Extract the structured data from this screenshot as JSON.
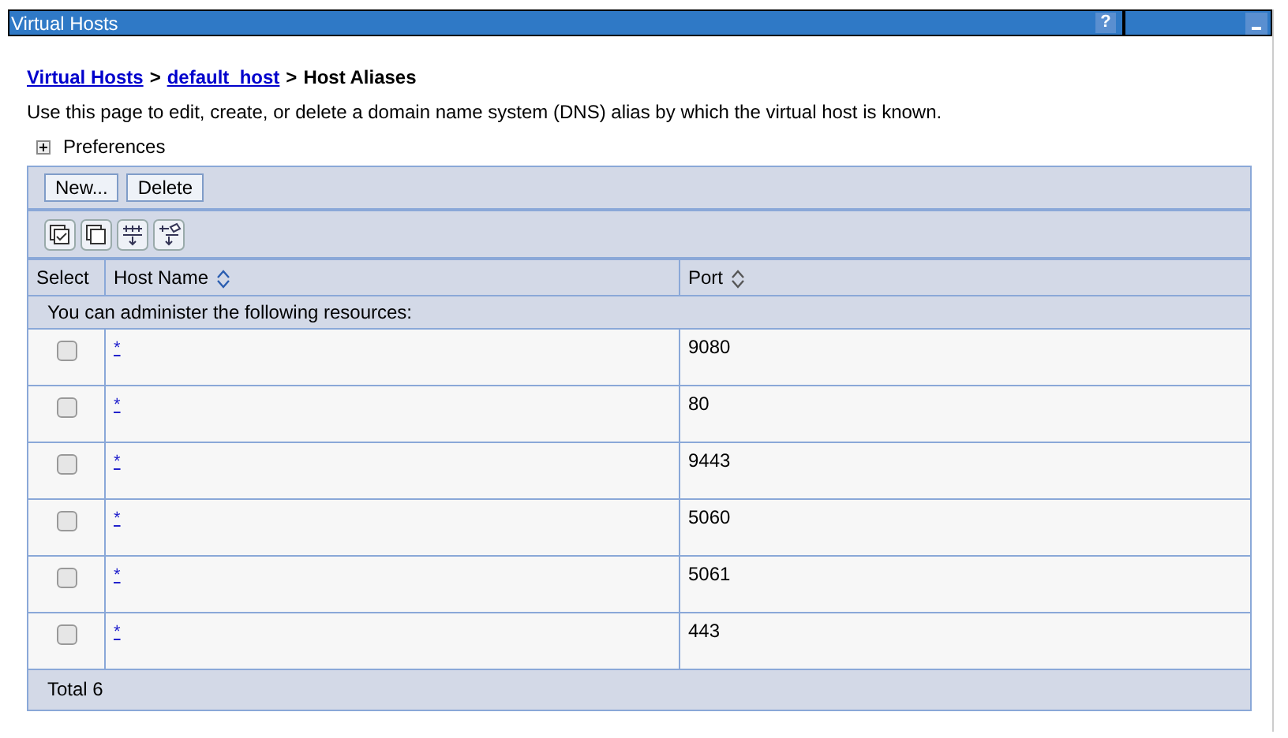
{
  "window": {
    "title": "Virtual Hosts",
    "help": "?"
  },
  "breadcrumb": {
    "links": [
      "Virtual Hosts",
      "default_host"
    ],
    "current": "Host Aliases",
    "separator": ">"
  },
  "description": "Use this page to edit, create, or delete a domain name system (DNS) alias by which the virtual host is known.",
  "preferences": {
    "label": "Preferences",
    "expanded": false
  },
  "buttons": [
    "New...",
    "Delete"
  ],
  "table": {
    "columns": [
      "Select",
      "Host Name",
      "Port"
    ],
    "group_label": "You can administer the following resources:",
    "rows": [
      {
        "host": "*",
        "port": "9080",
        "checked": false
      },
      {
        "host": "*",
        "port": "80",
        "checked": false
      },
      {
        "host": "*",
        "port": "9443",
        "checked": false
      },
      {
        "host": "*",
        "port": "5060",
        "checked": false
      },
      {
        "host": "*",
        "port": "5061",
        "checked": false
      },
      {
        "host": "*",
        "port": "443",
        "checked": false
      }
    ],
    "total": "Total 6"
  }
}
